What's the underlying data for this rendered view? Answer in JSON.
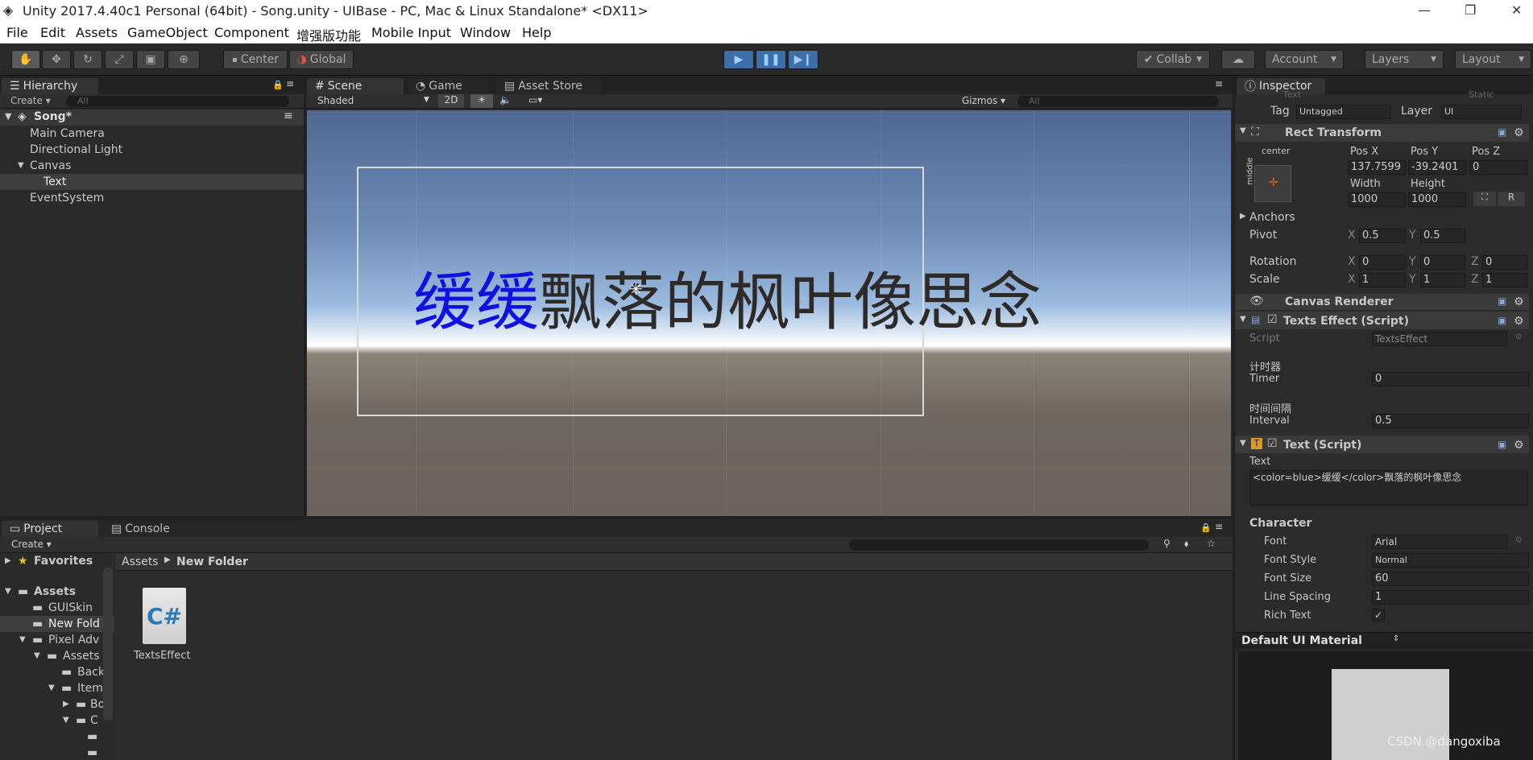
{
  "window": {
    "title": "Unity 2017.4.40c1 Personal (64bit) - Song.unity - UIBase - PC, Mac & Linux Standalone* <DX11>",
    "minimize": "—",
    "restore": "❐",
    "close": "✕"
  },
  "menu": [
    "File",
    "Edit",
    "Assets",
    "GameObject",
    "Component",
    "增强版功能",
    "Mobile Input",
    "Window",
    "Help"
  ],
  "toolbar": {
    "center": "Center",
    "global": "Global",
    "collab": "Collab",
    "account": "Account",
    "layers": "Layers",
    "layout": "Layout"
  },
  "hierarchy": {
    "tab": "Hierarchy",
    "create": "Create",
    "search": "All",
    "scene": "Song*",
    "items": [
      "Main Camera",
      "Directional Light",
      "Canvas",
      "Text",
      "EventSystem"
    ]
  },
  "scene": {
    "tabs": [
      "Scene",
      "Game",
      "Asset Store"
    ],
    "shaded": "Shaded",
    "mode2d": "2D",
    "gizmos": "Gizmos",
    "search": "All",
    "text_blue": "缓缓",
    "text_rest": "飘落的枫叶像思念",
    "blue_color": "#1010e0"
  },
  "project": {
    "tabs": [
      "Project",
      "Console"
    ],
    "create": "Create",
    "breadcrumb": [
      "Assets",
      "New Folder"
    ],
    "favorites": "Favorites",
    "assets": "Assets",
    "tree": [
      "GUISkin",
      "New Fold",
      "Pixel Adv",
      "Assets",
      "Back",
      "Item",
      "Bo",
      "C"
    ],
    "file": "TextsEffect",
    "file_icon": "C#"
  },
  "inspector": {
    "tab": "Inspector",
    "name": "Text",
    "static": "Static",
    "tag_label": "Tag",
    "tag": "Untagged",
    "layer_label": "Layer",
    "layer": "UI",
    "rect": {
      "title": "Rect Transform",
      "anchor_h": "center",
      "anchor_v": "middle",
      "posx_l": "Pos X",
      "posy_l": "Pos Y",
      "posz_l": "Pos Z",
      "posx": "137.7599",
      "posy": "-39.2401",
      "posz": "0",
      "width_l": "Width",
      "height_l": "Height",
      "width": "1000",
      "height": "1000",
      "r": "R",
      "anchors": "Anchors",
      "pivot": "Pivot",
      "pivx": "0.5",
      "pivy": "0.5",
      "rotation": "Rotation",
      "rotx": "0",
      "roty": "0",
      "rotz": "0",
      "scale": "Scale",
      "scx": "1",
      "scy": "1",
      "scz": "1",
      "x": "X",
      "y": "Y",
      "z": "Z"
    },
    "canvas_renderer": "Canvas Renderer",
    "effect": {
      "title": "Texts Effect (Script)",
      "script_l": "Script",
      "script": "TextsEffect",
      "timer_cn": "计时器",
      "timer_l": "Timer",
      "timer": "0",
      "interval_cn": "时间间隔",
      "interval_l": "Interval",
      "interval": "0.5"
    },
    "text": {
      "title": "Text (Script)",
      "text_l": "Text",
      "text_val": "<color=blue>缓缓</color>飘落的枫叶像思念",
      "character": "Character",
      "font_l": "Font",
      "font": "Arial",
      "style_l": "Font Style",
      "style": "Normal",
      "size_l": "Font Size",
      "size": "60",
      "spacing_l": "Line Spacing",
      "spacing": "1",
      "rich_l": "Rich Text",
      "rich": "✓"
    },
    "material": "Default UI Material"
  },
  "watermark": "CSDN @dangoxiba"
}
